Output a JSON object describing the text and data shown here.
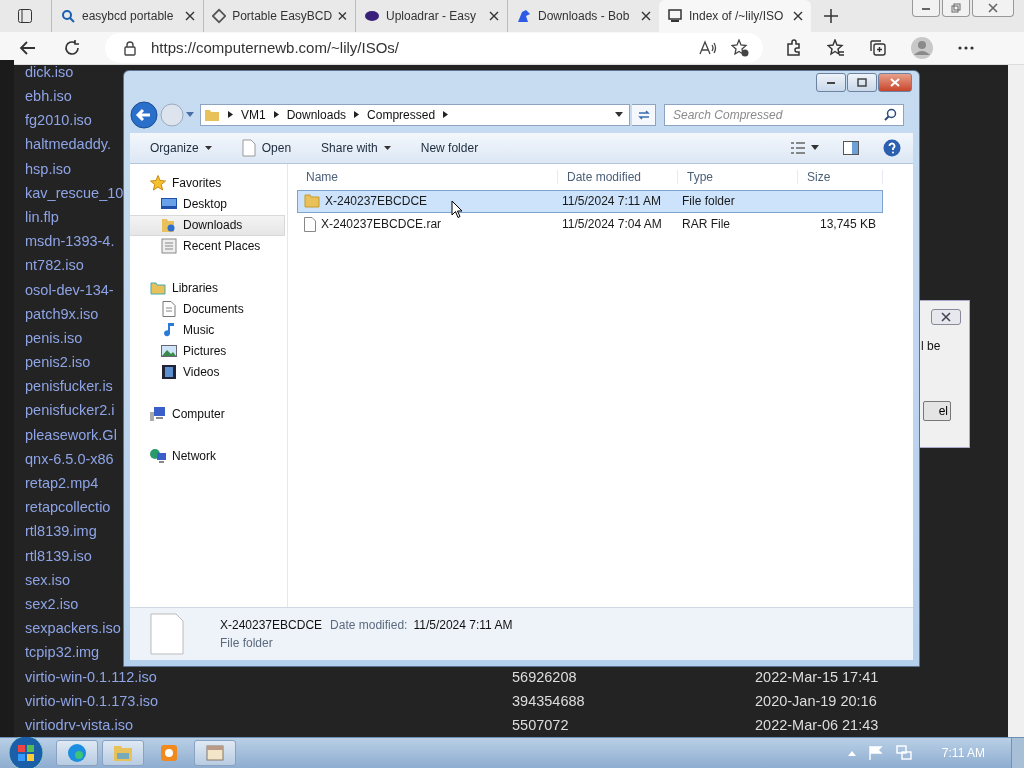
{
  "browser": {
    "tabs": [
      {
        "label": "easybcd portable",
        "kind": "search",
        "selected": false
      },
      {
        "label": "Portable EasyBCD",
        "kind": "diamond",
        "selected": false
      },
      {
        "label": "Uploadrar - Easy",
        "kind": "blob",
        "selected": false
      },
      {
        "label": "Downloads - Bob",
        "kind": "bird",
        "selected": false
      },
      {
        "label": "Index of /~lily/ISO",
        "kind": "pc",
        "selected": true
      }
    ],
    "address": "https://computernewb.com/~lily/ISOs/"
  },
  "listing": {
    "rows": [
      {
        "name": "dick.iso"
      },
      {
        "name": "ebh.iso"
      },
      {
        "name": "fg2010.iso"
      },
      {
        "name": "haltmedaddy."
      },
      {
        "name": "hsp.iso"
      },
      {
        "name": "kav_rescue_10"
      },
      {
        "name": "lin.flp"
      },
      {
        "name": "msdn-1393-4."
      },
      {
        "name": "nt782.iso"
      },
      {
        "name": "osol-dev-134-"
      },
      {
        "name": "patch9x.iso"
      },
      {
        "name": "penis.iso"
      },
      {
        "name": "penis2.iso"
      },
      {
        "name": "penisfucker.is"
      },
      {
        "name": "penisfucker2.i"
      },
      {
        "name": "pleasework.Gl"
      },
      {
        "name": "qnx-6.5.0-x86"
      },
      {
        "name": "retap2.mp4"
      },
      {
        "name": "retapcollectio"
      },
      {
        "name": "rtl8139.img"
      },
      {
        "name": "rtl8139.iso"
      },
      {
        "name": "sex.iso"
      },
      {
        "name": "sex2.iso"
      },
      {
        "name": "sexpackers.iso"
      },
      {
        "name": "tcpip32.img"
      },
      {
        "name": "virtio-win-0.1.112.iso",
        "size": "56926208",
        "date": "2022-Mar-15 17:41"
      },
      {
        "name": "virtio-win-0.1.173.iso",
        "size": "394354688",
        "date": "2020-Jan-19 20:16"
      },
      {
        "name": "virtiodrv-vista.iso",
        "size": "5507072",
        "date": "2022-Mar-06 21:43"
      }
    ]
  },
  "explorer": {
    "breadcrumb": [
      "VM1",
      "Downloads",
      "Compressed"
    ],
    "search": {
      "placeholder": "Search Compressed"
    },
    "toolbar": [
      {
        "label": "Organize",
        "kind": "menu"
      },
      {
        "label": "Open",
        "kind": "open"
      },
      {
        "label": "Share with",
        "kind": "menu"
      },
      {
        "label": "New folder",
        "kind": "plain"
      }
    ],
    "nav": [
      {
        "label": "Favorites",
        "kind": "star",
        "children": [
          {
            "label": "Desktop",
            "kind": "monitor",
            "selected": false
          },
          {
            "label": "Downloads",
            "kind": "folder",
            "selected": true
          },
          {
            "label": "Recent Places",
            "kind": "recent",
            "selected": false
          }
        ]
      },
      {
        "label": "Libraries",
        "kind": "folder",
        "children": [
          {
            "label": "Documents",
            "kind": "doc",
            "selected": false
          },
          {
            "label": "Music",
            "kind": "note",
            "selected": false
          },
          {
            "label": "Pictures",
            "kind": "picture",
            "selected": false
          },
          {
            "label": "Videos",
            "kind": "film",
            "selected": false
          }
        ]
      },
      {
        "label": "Computer",
        "kind": "computer"
      },
      {
        "label": "Network",
        "kind": "network"
      }
    ],
    "columns": [
      "Name",
      "Date modified",
      "Type",
      "Size"
    ],
    "files": [
      {
        "name": "X-240237EBCDCE",
        "kind": "folder",
        "date": "11/5/2024 7:11 AM",
        "type": "File folder",
        "selected": true
      },
      {
        "name": "X-240237EBCDCE.rar",
        "kind": "file",
        "date": "11/5/2024 7:04 AM",
        "type": "RAR File",
        "size": "13,745 KB",
        "selected": false
      }
    ],
    "details": {
      "name": "X-240237EBCDCE",
      "date_label": "Date modified:",
      "date": "11/5/2024 7:11 AM",
      "type": "File folder"
    }
  },
  "dialog": {
    "text": "l be",
    "button": "el"
  },
  "taskbar": {
    "clock": "7:11 AM"
  }
}
